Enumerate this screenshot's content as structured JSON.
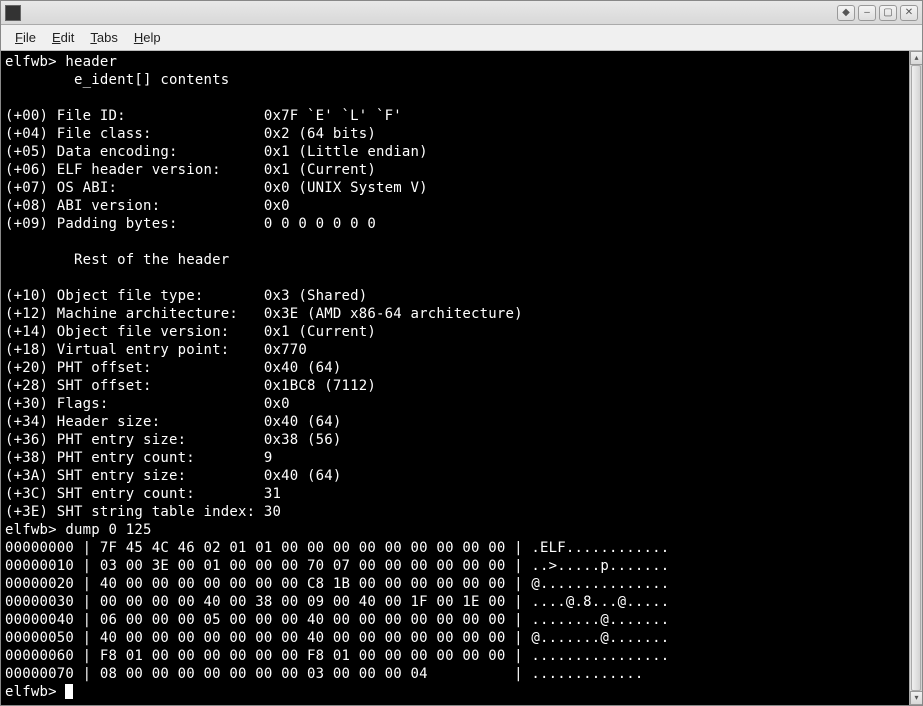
{
  "menubar": {
    "file": "File",
    "edit": "Edit",
    "tabs": "Tabs",
    "help": "Help"
  },
  "terminal": {
    "prompt": "elfwb>",
    "cmd_header": "header",
    "section_eident": "        e_ident[] contents",
    "header_lines": [
      "(+00) File ID:                0x7F `E' `L' `F'",
      "(+04) File class:             0x2 (64 bits)",
      "(+05) Data encoding:          0x1 (Little endian)",
      "(+06) ELF header version:     0x1 (Current)",
      "(+07) OS ABI:                 0x0 (UNIX System V)",
      "(+08) ABI version:            0x0",
      "(+09) Padding bytes:          0 0 0 0 0 0 0"
    ],
    "section_rest": "        Rest of the header",
    "rest_lines": [
      "(+10) Object file type:       0x3 (Shared)",
      "(+12) Machine architecture:   0x3E (AMD x86-64 architecture)",
      "(+14) Object file version:    0x1 (Current)",
      "(+18) Virtual entry point:    0x770",
      "(+20) PHT offset:             0x40 (64)",
      "(+28) SHT offset:             0x1BC8 (7112)",
      "(+30) Flags:                  0x0",
      "(+34) Header size:            0x40 (64)",
      "(+36) PHT entry size:         0x38 (56)",
      "(+38) PHT entry count:        9",
      "(+3A) SHT entry size:         0x40 (64)",
      "(+3C) SHT entry count:        31",
      "(+3E) SHT string table index: 30"
    ],
    "cmd_dump": "dump 0 125",
    "dump_lines": [
      "00000000 | 7F 45 4C 46 02 01 01 00 00 00 00 00 00 00 00 00 | .ELF............",
      "00000010 | 03 00 3E 00 01 00 00 00 70 07 00 00 00 00 00 00 | ..>.....p.......",
      "00000020 | 40 00 00 00 00 00 00 00 C8 1B 00 00 00 00 00 00 | @...............",
      "00000030 | 00 00 00 00 40 00 38 00 09 00 40 00 1F 00 1E 00 | ....@.8...@.....",
      "00000040 | 06 00 00 00 05 00 00 00 40 00 00 00 00 00 00 00 | ........@.......",
      "00000050 | 40 00 00 00 00 00 00 00 40 00 00 00 00 00 00 00 | @.......@.......",
      "00000060 | F8 01 00 00 00 00 00 00 F8 01 00 00 00 00 00 00 | ................",
      "00000070 | 08 00 00 00 00 00 00 00 03 00 00 00 04          | ............."
    ]
  }
}
